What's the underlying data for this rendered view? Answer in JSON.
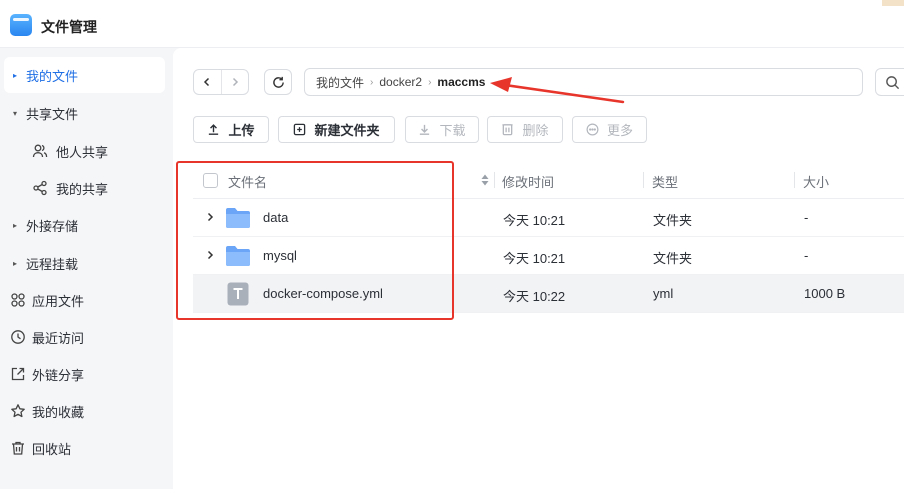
{
  "app": {
    "title": "文件管理",
    "accent": "#1f6fe5"
  },
  "sidebar": {
    "items": [
      {
        "label": "我的文件",
        "icon": "caret-right-icon",
        "active": true
      },
      {
        "label": "共享文件",
        "icon": "caret-down-icon"
      },
      {
        "label": "他人共享",
        "icon": "users-icon"
      },
      {
        "label": "我的共享",
        "icon": "share-nodes-icon"
      },
      {
        "label": "外接存储",
        "icon": "caret-right-icon"
      },
      {
        "label": "远程挂载",
        "icon": "caret-right-icon"
      },
      {
        "label": "应用文件",
        "icon": "apps-grid-icon"
      },
      {
        "label": "最近访问",
        "icon": "clock-icon"
      },
      {
        "label": "外链分享",
        "icon": "external-link-icon"
      },
      {
        "label": "我的收藏",
        "icon": "star-icon"
      },
      {
        "label": "回收站",
        "icon": "trash-icon"
      }
    ]
  },
  "breadcrumb": {
    "parts": [
      "我的文件",
      "docker2",
      "maccms"
    ]
  },
  "toolbar": {
    "upload": "上传",
    "new_folder": "新建文件夹",
    "download": "下载",
    "delete": "删除",
    "more": "更多"
  },
  "table": {
    "columns": [
      "文件名",
      "修改时间",
      "类型",
      "大小"
    ],
    "rows": [
      {
        "name": "data",
        "modified": "今天 10:21",
        "type": "文件夹",
        "size": "-",
        "kind": "folder"
      },
      {
        "name": "mysql",
        "modified": "今天 10:21",
        "type": "文件夹",
        "size": "-",
        "kind": "folder"
      },
      {
        "name": "docker-compose.yml",
        "modified": "今天 10:22",
        "type": "yml",
        "size": "1000 B",
        "kind": "text-file"
      }
    ]
  },
  "annotation": {
    "color": "#e8352b"
  }
}
